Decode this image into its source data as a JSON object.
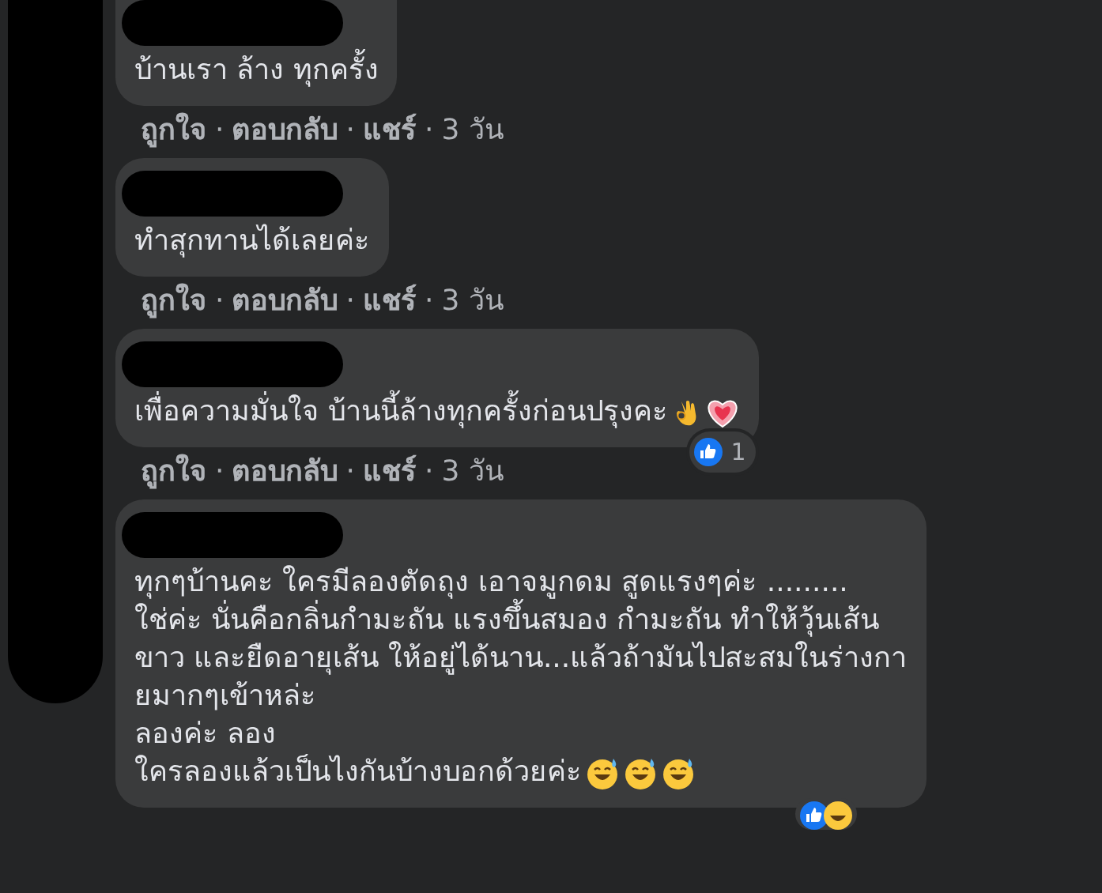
{
  "comments": [
    {
      "lines": [
        "บ้านเรา ล้าง ทุกครั้ง"
      ],
      "actions": [
        "ถูกใจ",
        "ตอบกลับ",
        "แชร์"
      ],
      "separator": "·",
      "time": "3 วัน",
      "top_cut": true
    },
    {
      "lines": [
        "ทำสุกทานได้เลยค่ะ"
      ],
      "actions": [
        "ถูกใจ",
        "ตอบกลับ",
        "แชร์"
      ],
      "separator": "·",
      "time": "3 วัน",
      "top_cut": false
    },
    {
      "lines": [
        "เพื่อความมั่นใจ บ้านนี้ล้างทุกครั้งก่อนปรุงคะ"
      ],
      "icons": [
        {
          "kind": "ok_hand"
        },
        {
          "kind": "heart"
        }
      ],
      "actions": [
        "ถูกใจ",
        "ตอบกลับ",
        "แชร์"
      ],
      "separator": "·",
      "time": "3 วัน",
      "top_cut": false,
      "reaction_count": "1"
    },
    {
      "lines": [
        "ทุกๆบ้านคะ ใครมีลองตัดถุง เอาจมูกดม สูดแรงๆค่ะ .........",
        "ใช่ค่ะ นั่นคือกลิ่นกำมะถัน แรงขึ้นสมอง กำมะถัน ทำให้วุ้นเส้น",
        "ขาว และยืดอายุเส้น ให้อยู่ได้นาน...แล้วถ้ามันไปสะสมในร่างกา",
        "ยมากๆเข้าหล่ะ",
        "ลองค่ะ ลอง",
        "ใครลองแล้วเป็นไงกันบ้างบอกด้วยค่ะ"
      ],
      "icons": [
        {
          "kind": "sweat_smile"
        },
        {
          "kind": "sweat_smile"
        },
        {
          "kind": "sweat_smile"
        }
      ],
      "top_cut": false,
      "reactions_peek": true
    }
  ]
}
